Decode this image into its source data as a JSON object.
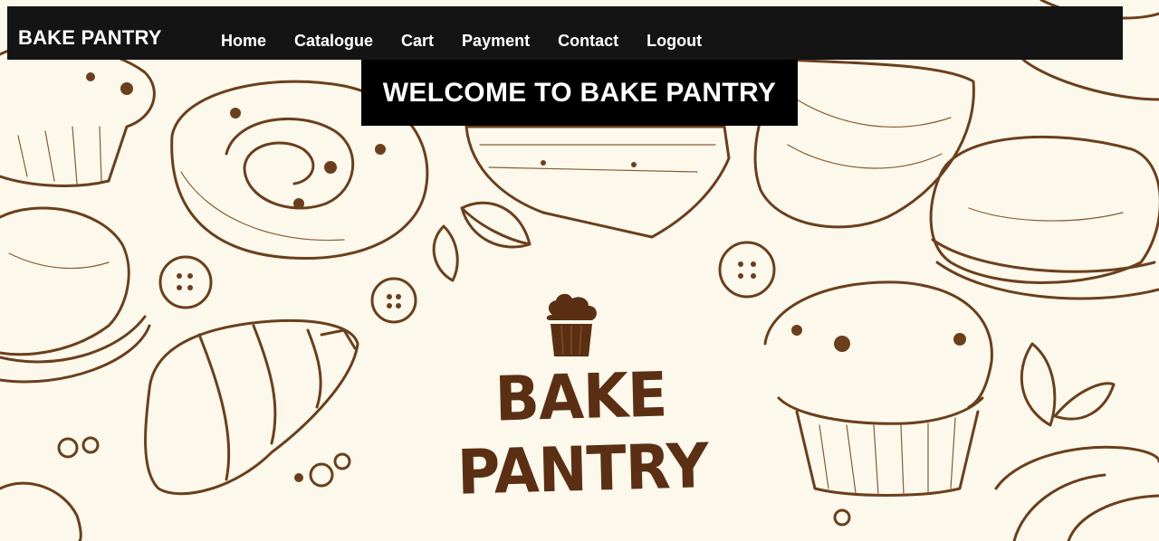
{
  "navbar": {
    "brand": "BAKE PANTRY",
    "links": [
      "Home",
      "Catalogue",
      "Cart",
      "Payment",
      "Contact",
      "Logout"
    ]
  },
  "banner": {
    "title": "WELCOME TO BAKE PANTRY"
  },
  "logo": {
    "text": "BAKE PANTRY",
    "icon": "cupcake-icon"
  },
  "colors": {
    "background": "#fcf9ec",
    "navbar": "#141414",
    "banner": "#000000",
    "illustration": "#6b3f1d",
    "logo": "#5b2f14"
  }
}
